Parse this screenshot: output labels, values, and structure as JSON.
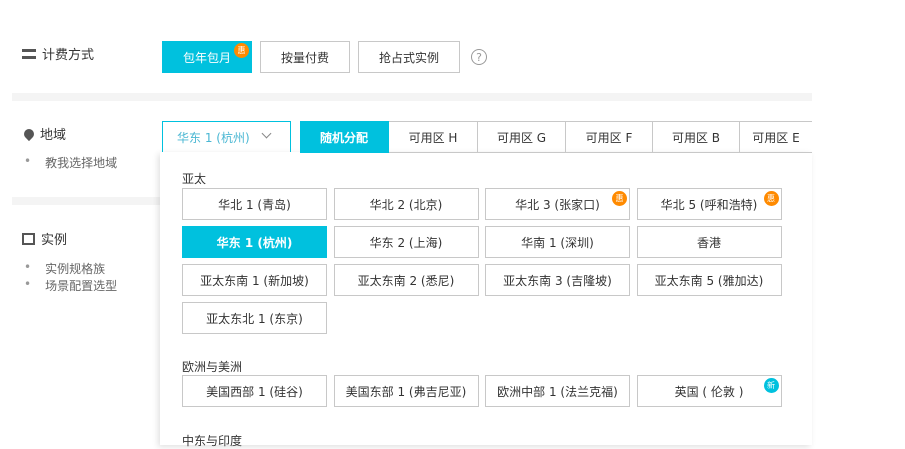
{
  "billing": {
    "label": "计费方式",
    "options": [
      {
        "label": "包年包月",
        "badge": "惠",
        "selected": true
      },
      {
        "label": "按量付费"
      },
      {
        "label": "抢占式实例"
      }
    ],
    "help": "?"
  },
  "region": {
    "label": "地域",
    "links": [
      "教我选择地域"
    ],
    "selected": "华东 1 (杭州)",
    "zones": [
      "随机分配",
      "可用区 H",
      "可用区 G",
      "可用区 F",
      "可用区 B",
      "可用区 E"
    ]
  },
  "instance": {
    "label": "实例",
    "links": [
      "实例规格族",
      "场景配置选型"
    ]
  },
  "dropdown": {
    "groups": [
      {
        "title": "亚太",
        "items": [
          {
            "label": "华北 1 (青岛)"
          },
          {
            "label": "华北 2 (北京)"
          },
          {
            "label": "华北 3 (张家口)",
            "badge": "惠"
          },
          {
            "label": "华北 5 (呼和浩特)",
            "badge": "惠"
          },
          {
            "label": "华东 1 (杭州)",
            "selected": true
          },
          {
            "label": "华东 2 (上海)"
          },
          {
            "label": "华南 1 (深圳)"
          },
          {
            "label": "香港"
          },
          {
            "label": "亚太东南 1 (新加坡)"
          },
          {
            "label": "亚太东南 2 (悉尼)"
          },
          {
            "label": "亚太东南 3 (吉隆坡)"
          },
          {
            "label": "亚太东南 5 (雅加达)"
          },
          {
            "label": "亚太东北 1 (东京)"
          }
        ]
      },
      {
        "title": "欧洲与美洲",
        "items": [
          {
            "label": "美国西部 1 (硅谷)"
          },
          {
            "label": "美国东部 1 (弗吉尼亚)"
          },
          {
            "label": "欧洲中部 1 (法兰克福)"
          },
          {
            "label": "英国 ( 伦敦 )",
            "badge": "新",
            "badgeType": "new"
          }
        ]
      },
      {
        "title": "中东与印度",
        "items": []
      }
    ]
  },
  "colors": {
    "accent": "#00c1de",
    "hot": "#ff8a00"
  }
}
